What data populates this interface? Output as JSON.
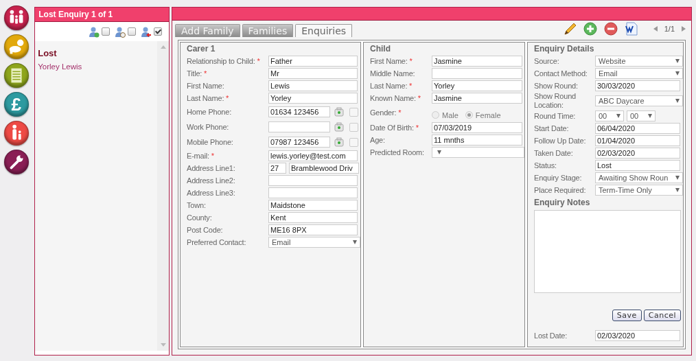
{
  "nav": [
    {
      "kind": "family",
      "color": "#c8234e"
    },
    {
      "kind": "baby",
      "color": "#e2a90c"
    },
    {
      "kind": "document",
      "color": "#8ea51c"
    },
    {
      "kind": "pound",
      "color": "#2e9aa0",
      "glyph": "£"
    },
    {
      "kind": "parent-child",
      "color": "#ee4a45"
    },
    {
      "kind": "wrench",
      "color": "#8a1f55"
    }
  ],
  "list_panel": {
    "title": "Lost Enquiry 1 of 1",
    "filters": [
      {
        "kind": "check",
        "checked": false
      },
      {
        "kind": "clock",
        "checked": false
      },
      {
        "kind": "arrow",
        "checked": true
      }
    ],
    "groups": [
      {
        "title": "Lost",
        "items": [
          "Yorley Lewis"
        ]
      }
    ]
  },
  "tabs": [
    {
      "label": "Add Family",
      "selected": false
    },
    {
      "label": "Families",
      "selected": false
    },
    {
      "label": "Enquiries",
      "selected": true
    }
  ],
  "toolbar": {
    "tools": [
      {
        "kind": "edit"
      },
      {
        "kind": "add"
      },
      {
        "kind": "remove"
      },
      {
        "kind": "word"
      }
    ],
    "pager": "1/1"
  },
  "carer": {
    "title": "Carer 1",
    "fields": [
      {
        "label": "Relationship to Child:",
        "required_mark": "*",
        "kind": "text",
        "value": "Father"
      },
      {
        "label": "Title:",
        "required_mark": "*",
        "kind": "text",
        "value": "Mr"
      },
      {
        "label": "First Name:",
        "kind": "text",
        "value": "Lewis"
      },
      {
        "label": "Last Name:",
        "required_mark": "*",
        "kind": "text",
        "value": "Yorley"
      },
      {
        "label": "Home Phone:",
        "kind": "phone",
        "value": "01634 123456",
        "checked": false
      },
      {
        "label": "Work Phone:",
        "kind": "phone",
        "checked": false
      },
      {
        "label": "Mobile Phone:",
        "kind": "phone",
        "value": "07987 123456",
        "checked": false
      },
      {
        "label": "E-mail:",
        "required_mark": "*",
        "kind": "text",
        "value": "lewis.yorley@test.com"
      },
      {
        "label": "Address Line1:",
        "kind": "address",
        "values": [
          "27",
          "Bramblewood Driv"
        ]
      },
      {
        "label": "Address Line2:",
        "kind": "text"
      },
      {
        "label": "Address Line3:",
        "kind": "text"
      },
      {
        "label": "Town:",
        "kind": "text",
        "value": "Maidstone"
      },
      {
        "label": "County:",
        "kind": "text",
        "value": "Kent"
      },
      {
        "label": "Post Code:",
        "kind": "text",
        "value": "ME16 8PX"
      },
      {
        "label": "Preferred Contact:",
        "kind": "select",
        "value": "Email"
      }
    ]
  },
  "child": {
    "title": "Child",
    "fields": [
      {
        "label": "First Name:",
        "required_mark": "*",
        "kind": "text",
        "value": "Jasmine"
      },
      {
        "label": "Middle Name:",
        "kind": "text"
      },
      {
        "label": "Last Name:",
        "required_mark": "*",
        "kind": "text",
        "value": "Yorley"
      },
      {
        "label": "Known Name:",
        "required_mark": "*",
        "kind": "text",
        "value": "Jasmine"
      },
      {
        "label": "Gender:",
        "required_mark": "*",
        "kind": "radio",
        "options": [
          {
            "label": "Male",
            "selected": false
          },
          {
            "label": "Female",
            "selected": true
          }
        ]
      },
      {
        "label": "Date Of Birth:",
        "required_mark": "*",
        "kind": "text",
        "value": "07/03/2019"
      },
      {
        "label": "Age:",
        "kind": "text",
        "value": "11 mnths"
      },
      {
        "label": "Predicted Room:",
        "kind": "select"
      }
    ]
  },
  "enquiry": {
    "title": "Enquiry Details",
    "fields": [
      {
        "label": "Source:",
        "kind": "select",
        "value": "Website"
      },
      {
        "label": "Contact Method:",
        "kind": "select",
        "value": "Email"
      },
      {
        "label": "Show Round:",
        "kind": "text",
        "value": "30/03/2020"
      },
      {
        "label": "Show Round Location:",
        "kind": "select",
        "value": "ABC Daycare"
      },
      {
        "label": "Round Time:",
        "kind": "time",
        "values": [
          "00",
          "00"
        ]
      },
      {
        "label": "Start Date:",
        "kind": "text",
        "value": "06/04/2020"
      },
      {
        "label": "Follow Up Date:",
        "kind": "text",
        "value": "01/04/2020"
      },
      {
        "label": "Taken Date:",
        "kind": "text",
        "value": "02/03/2020"
      },
      {
        "label": "Status:",
        "kind": "text",
        "value": "Lost"
      },
      {
        "label": "Enquiry Stage:",
        "kind": "select",
        "value": "Awaiting Show Roun"
      },
      {
        "label": "Place Required:",
        "kind": "select",
        "value": "Term-Time Only"
      }
    ],
    "notes_title": "Enquiry Notes",
    "buttons": [
      "Save",
      "Cancel"
    ],
    "lost_date": {
      "label": "Lost Date:",
      "kind": "text",
      "value": "02/03/2020"
    }
  }
}
